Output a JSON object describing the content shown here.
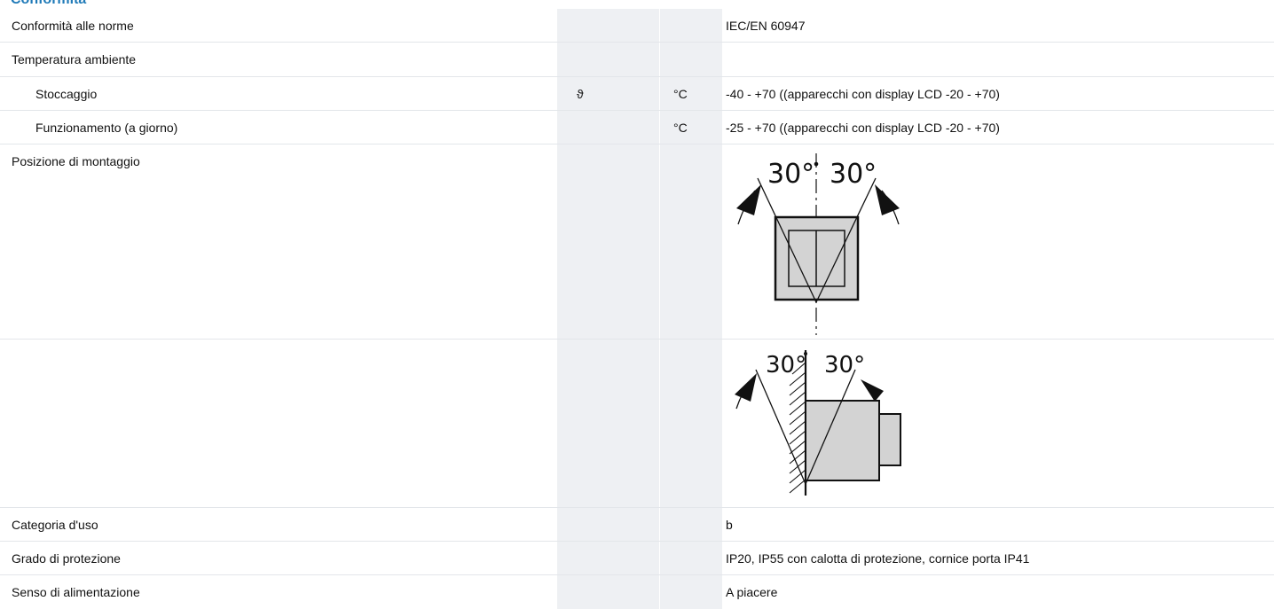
{
  "section_title": "Conformità",
  "rows": [
    {
      "label": "Conformità alle norme",
      "symbol": "",
      "unit": "",
      "value": "IEC/EN 60947"
    },
    {
      "label": "Temperatura ambiente",
      "symbol": "",
      "unit": "",
      "value": ""
    },
    {
      "label": "Stoccaggio",
      "symbol": "ϑ",
      "unit": "°C",
      "value": "-40 - +70 ((apparecchi con display LCD -20 - +70)"
    },
    {
      "label": "Funzionamento (a giorno)",
      "symbol": "",
      "unit": "°C",
      "value": "-25 - +70 ((apparecchi con display LCD -20 - +70)"
    },
    {
      "label": "Posizione di montaggio",
      "symbol": "",
      "unit": "",
      "value": ""
    },
    {
      "label": "",
      "symbol": "",
      "unit": "",
      "value": ""
    },
    {
      "label": "Categoria d'uso",
      "symbol": "",
      "unit": "",
      "value": "b"
    },
    {
      "label": "Grado di protezione",
      "symbol": "",
      "unit": "",
      "value": "IP20, IP55 con calotta di protezione, cornice porta IP41"
    },
    {
      "label": "Senso di alimentazione",
      "symbol": "",
      "unit": "",
      "value": "A piacere"
    }
  ],
  "diagrams": {
    "front_angle_left": "30°",
    "front_angle_right": "30°",
    "side_angle_left": "30°",
    "side_angle_right": "30°"
  }
}
